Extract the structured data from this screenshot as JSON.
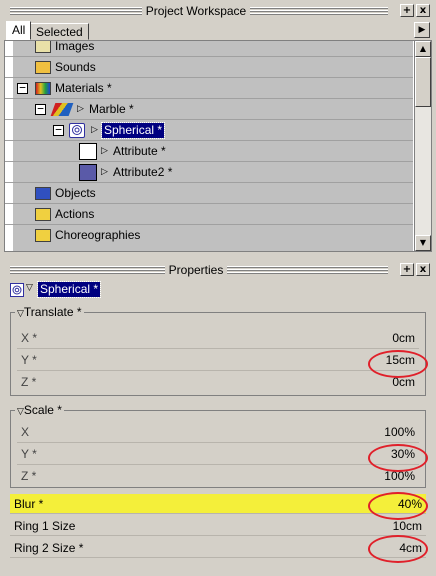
{
  "workspace": {
    "title": "Project Workspace",
    "pin_label": "+",
    "close_label": "x",
    "tabs": [
      "All",
      "Selected"
    ],
    "tab_arrow": "▶",
    "tree": [
      {
        "label": "Images",
        "icon": "images-icon",
        "indent": 1
      },
      {
        "label": "Sounds",
        "icon": "sounds-icon",
        "indent": 1
      },
      {
        "label": "Materials *",
        "icon": "materials-icon",
        "indent": 0,
        "expander": "−"
      },
      {
        "label": "Marble *",
        "icon": "marble-icon",
        "indent": 1,
        "expander": "−"
      },
      {
        "label": "Spherical *",
        "icon": "spherical-icon",
        "indent": 2,
        "expander": "−",
        "selected": true
      },
      {
        "label": "Attribute *",
        "icon": "attribute-swatch",
        "indent": 3,
        "swatch": "#ffffff"
      },
      {
        "label": "Attribute2 *",
        "icon": "attribute2-swatch",
        "indent": 3,
        "swatch": "#5a5aa8"
      },
      {
        "label": "Objects",
        "icon": "objects-icon",
        "indent": 1
      },
      {
        "label": "Actions",
        "icon": "actions-icon",
        "indent": 1
      },
      {
        "label": "Choreographies",
        "icon": "choreographies-icon",
        "indent": 1
      }
    ]
  },
  "properties": {
    "title": "Properties",
    "pin_label": "+",
    "close_label": "x",
    "header_label": "Spherical *",
    "translate": {
      "title": "Translate *",
      "rows": [
        {
          "key": "X *",
          "value": "0cm"
        },
        {
          "key": "Y *",
          "value": "15cm",
          "circled": true
        },
        {
          "key": "Z *",
          "value": "0cm"
        }
      ]
    },
    "scale": {
      "title": "Scale *",
      "rows": [
        {
          "key": "X",
          "value": "100%"
        },
        {
          "key": "Y *",
          "value": "30%",
          "circled": true
        },
        {
          "key": "Z *",
          "value": "100%"
        }
      ]
    },
    "fields": [
      {
        "key": "Blur *",
        "value": "40%",
        "highlight": true,
        "circled": true
      },
      {
        "key": "Ring 1 Size",
        "value": "10cm"
      },
      {
        "key": "Ring 2 Size *",
        "value": "4cm",
        "circled": true
      }
    ]
  },
  "colors": {
    "selection": "#000080",
    "highlight": "#f4ef3a",
    "annotation": "#e0202a"
  }
}
